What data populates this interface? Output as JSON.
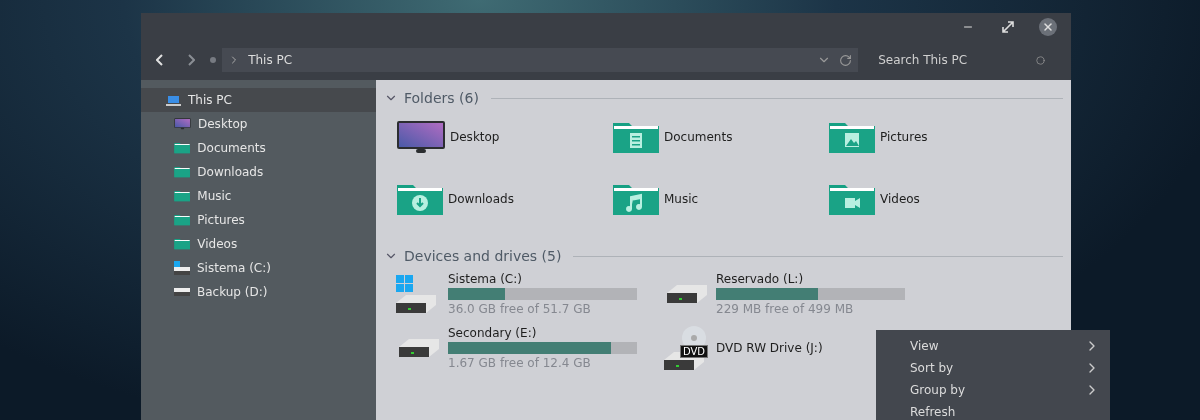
{
  "address": {
    "path": "This PC"
  },
  "search": {
    "placeholder": "Search This PC"
  },
  "sidebar": {
    "items": [
      {
        "label": "This PC",
        "kind": "pc",
        "selected": true
      },
      {
        "label": "Desktop",
        "kind": "desktop",
        "selected": false
      },
      {
        "label": "Documents",
        "kind": "folder",
        "selected": false
      },
      {
        "label": "Downloads",
        "kind": "folder",
        "selected": false
      },
      {
        "label": "Music",
        "kind": "folder",
        "selected": false
      },
      {
        "label": "Pictures",
        "kind": "folder",
        "selected": false
      },
      {
        "label": "Videos",
        "kind": "folder",
        "selected": false
      },
      {
        "label": "Sistema (C:)",
        "kind": "system-drive",
        "selected": false
      },
      {
        "label": "Backup (D:)",
        "kind": "drive",
        "selected": false
      }
    ]
  },
  "folders": {
    "title": "Folders (6)",
    "items": [
      {
        "label": "Desktop",
        "kind": "desktop"
      },
      {
        "label": "Documents",
        "kind": "documents"
      },
      {
        "label": "Pictures",
        "kind": "pictures"
      },
      {
        "label": "Downloads",
        "kind": "downloads"
      },
      {
        "label": "Music",
        "kind": "music"
      },
      {
        "label": "Videos",
        "kind": "videos"
      }
    ]
  },
  "drives": {
    "title": "Devices and drives (5)",
    "items": [
      {
        "label": "Sistema (C:)",
        "kind": "system",
        "level": 0.3,
        "free": "36.0 GB free of 51.7 GB"
      },
      {
        "label": "Reservado (L:)",
        "kind": "hdd",
        "level": 0.54,
        "free": "229 MB free of 499 MB"
      },
      {
        "label": "Secondary (E:)",
        "kind": "hdd",
        "level": 0.865,
        "free": "1.67 GB free of 12.4 GB"
      },
      {
        "label": "DVD RW Drive (J:)",
        "kind": "dvd",
        "disc_label": "DVD"
      }
    ]
  },
  "context_menu": {
    "items": [
      {
        "label": "View",
        "submenu": true
      },
      {
        "label": "Sort by",
        "submenu": true
      },
      {
        "label": "Group by",
        "submenu": true
      },
      {
        "label": "Refresh",
        "submenu": false
      }
    ]
  }
}
